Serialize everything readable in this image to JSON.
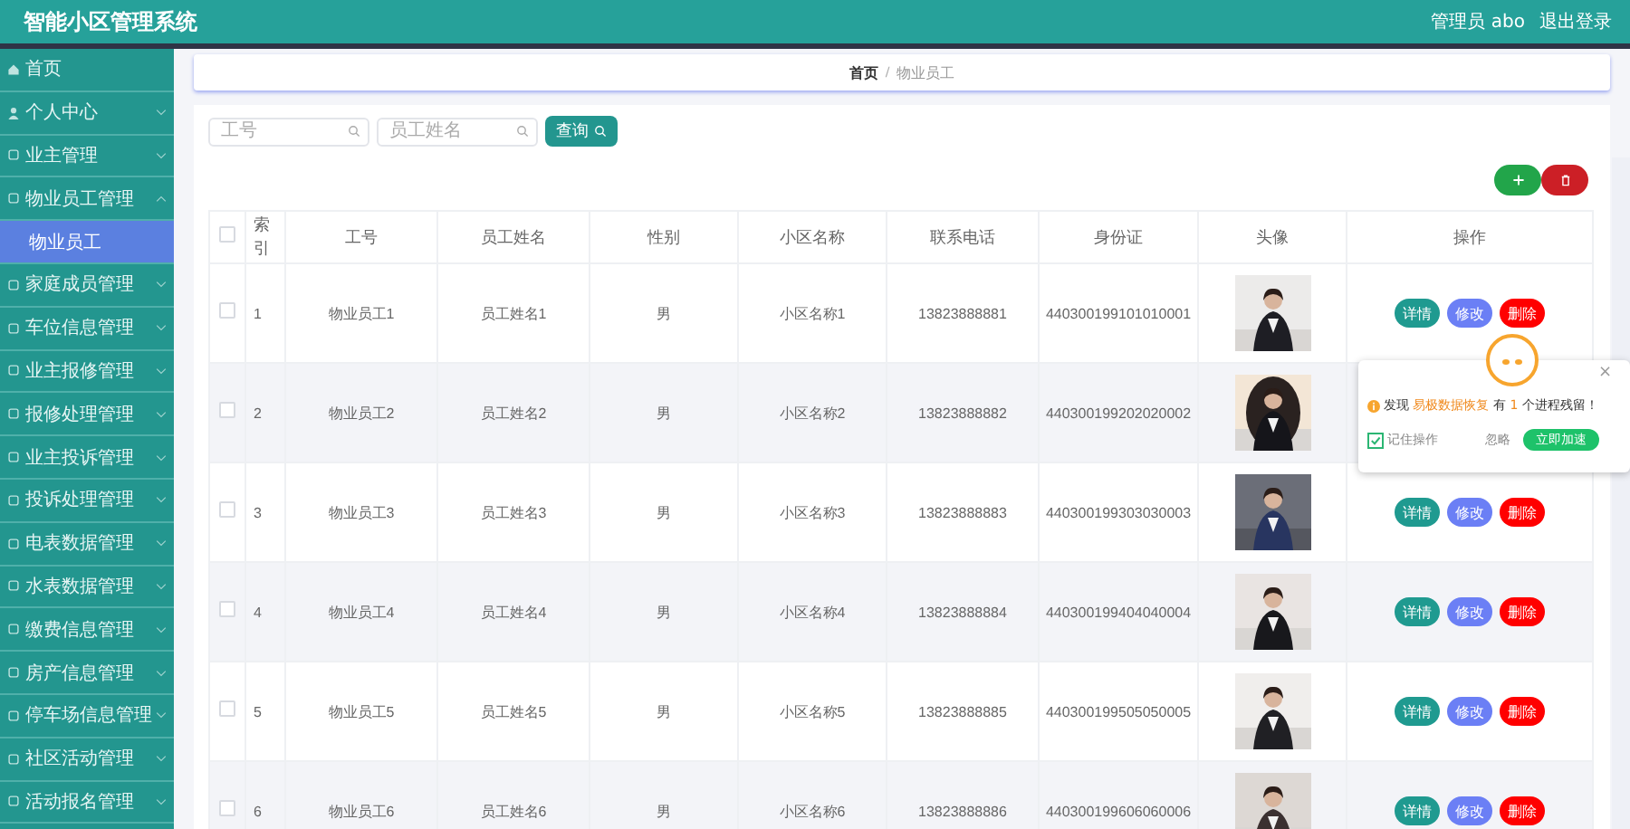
{
  "header": {
    "title": "智能小区管理系统",
    "user": "管理员 abo",
    "logout": "退出登录"
  },
  "sidebar": {
    "items": [
      {
        "label": "首页",
        "kind": "link",
        "selected": false
      },
      {
        "label": "个人中心",
        "kind": "menu",
        "expanded": false,
        "selected": false
      },
      {
        "label": "业主管理",
        "kind": "menu",
        "expanded": false,
        "selected": false
      },
      {
        "label": "物业员工管理",
        "kind": "menu",
        "expanded": true,
        "selected": false,
        "children": [
          {
            "label": "物业员工",
            "kind": "link",
            "selected": true
          }
        ]
      },
      {
        "label": "家庭成员管理",
        "kind": "menu",
        "expanded": false,
        "selected": false
      },
      {
        "label": "车位信息管理",
        "kind": "menu",
        "expanded": false,
        "selected": false
      },
      {
        "label": "业主报修管理",
        "kind": "menu",
        "expanded": false,
        "selected": false
      },
      {
        "label": "报修处理管理",
        "kind": "menu",
        "expanded": false,
        "selected": false
      },
      {
        "label": "业主投诉管理",
        "kind": "menu",
        "expanded": false,
        "selected": false
      },
      {
        "label": "投诉处理管理",
        "kind": "menu",
        "expanded": false,
        "selected": false
      },
      {
        "label": "电表数据管理",
        "kind": "menu",
        "expanded": false,
        "selected": false
      },
      {
        "label": "水表数据管理",
        "kind": "menu",
        "expanded": false,
        "selected": false
      },
      {
        "label": "缴费信息管理",
        "kind": "menu",
        "expanded": false,
        "selected": false
      },
      {
        "label": "房产信息管理",
        "kind": "menu",
        "expanded": false,
        "selected": false
      },
      {
        "label": "停车场信息管理",
        "kind": "menu",
        "expanded": false,
        "selected": false
      },
      {
        "label": "社区活动管理",
        "kind": "menu",
        "expanded": false,
        "selected": false
      },
      {
        "label": "活动报名管理",
        "kind": "menu",
        "expanded": false,
        "selected": false
      }
    ]
  },
  "breadcrumb": {
    "items": [
      "首页",
      "物业员工"
    ],
    "separator": "/"
  },
  "search": {
    "fields": [
      {
        "placeholder": "工号"
      },
      {
        "placeholder": "员工姓名"
      }
    ],
    "button": "查询"
  },
  "table": {
    "columns": [
      "索引",
      "工号",
      "员工姓名",
      "性别",
      "小区名称",
      "联系电话",
      "身份证",
      "头像",
      "操作"
    ],
    "header_checked": false,
    "rows": [
      {
        "checked": false,
        "index": "1",
        "job_no": "物业员工1",
        "name": "员工姓名1",
        "gender": "男",
        "community": "小区名称1",
        "phone": "13823888881",
        "id_card": "440300199101010001",
        "actions": [
          "详情",
          "修改",
          "删除"
        ]
      },
      {
        "checked": false,
        "index": "2",
        "job_no": "物业员工2",
        "name": "员工姓名2",
        "gender": "男",
        "community": "小区名称2",
        "phone": "13823888882",
        "id_card": "440300199202020002"
      },
      {
        "checked": false,
        "index": "3",
        "job_no": "物业员工3",
        "name": "员工姓名3",
        "gender": "男",
        "community": "小区名称3",
        "phone": "13823888883",
        "id_card": "440300199303030003",
        "actions": [
          "详情",
          "修改",
          "删除"
        ]
      },
      {
        "checked": false,
        "index": "4",
        "job_no": "物业员工4",
        "name": "员工姓名4",
        "gender": "男",
        "community": "小区名称4",
        "phone": "13823888884",
        "id_card": "440300199404040004",
        "actions": [
          "详情",
          "修改",
          "删除"
        ]
      },
      {
        "checked": false,
        "index": "5",
        "job_no": "物业员工5",
        "name": "员工姓名5",
        "gender": "男",
        "community": "小区名称5",
        "phone": "13823888885",
        "id_card": "440300199505050005",
        "actions": [
          "详情",
          "修改",
          "删除"
        ]
      },
      {
        "checked": false,
        "index": "6",
        "job_no": "物业员工6",
        "name": "员工姓名6",
        "gender": "男",
        "community": "小区名称6",
        "phone": "13823888886",
        "id_card": "440300199606060006",
        "actions": [
          "详情",
          "修改",
          "删除"
        ]
      }
    ]
  },
  "popup": {
    "message": [
      {
        "text": "发现 ",
        "highlight": false
      },
      {
        "text": "易极数据恢复",
        "highlight": true
      },
      {
        "text": " 有 ",
        "highlight": false
      },
      {
        "text": "1",
        "highlight": true
      },
      {
        "text": " 个进程残留！",
        "highlight": false
      }
    ],
    "close": "×",
    "remember": {
      "label": "记住操作",
      "checked": true
    },
    "ignore": "忽略",
    "accelerate": "立即加速"
  }
}
